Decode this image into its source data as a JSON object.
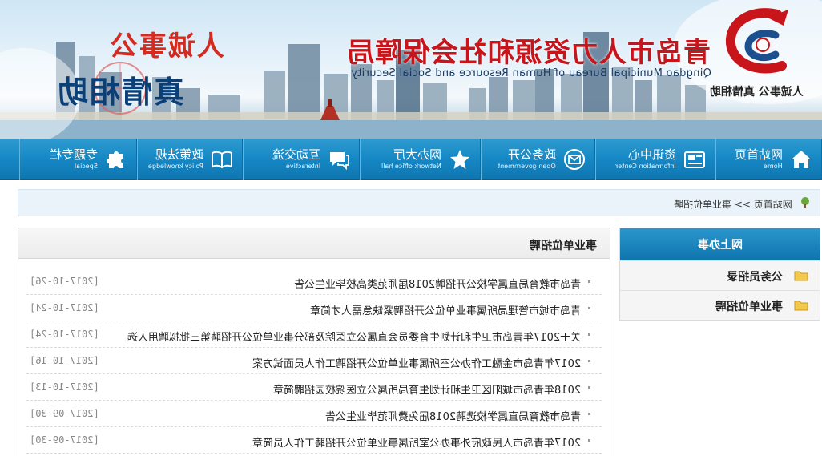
{
  "header": {
    "site_title": "青岛市人力资源和社会保障局",
    "site_subtitle": "Qingdao Municipal Bureau of Human Resource and Social Security",
    "logo_slogan": "人诚事公 真情相助",
    "slogan_line1": "人诚事公",
    "slogan_line2": "真情相助"
  },
  "nav": {
    "items": [
      {
        "label": "网站首页",
        "en": "Home",
        "icon": "home-icon"
      },
      {
        "label": "资讯中心",
        "en": "Information Center",
        "icon": "news-icon"
      },
      {
        "label": "政务公开",
        "en": "Open government",
        "icon": "envelope-icon"
      },
      {
        "label": "网办大厅",
        "en": "Network office hall",
        "icon": "star-icon"
      },
      {
        "label": "互动交流",
        "en": "Interactive",
        "icon": "chat-icon"
      },
      {
        "label": "政策法规",
        "en": "Policy knowledge",
        "icon": "book-icon"
      },
      {
        "label": "专题专栏",
        "en": "Special",
        "icon": "puzzle-icon"
      }
    ]
  },
  "breadcrumb": {
    "text": "网站首页 >> 事业单位招聘",
    "icon": "tree-icon"
  },
  "list": {
    "title": "事业单位招聘",
    "rows": [
      {
        "title": "青岛市教育局直属学校公开招聘2018届师范类高校毕业生公告",
        "date": "[2017-10-26]"
      },
      {
        "title": "青岛市城市管理局所属事业单位公开招聘紧缺急需人才简章",
        "date": "[2017-10-24]"
      },
      {
        "title": "关于2017年青岛市卫生和计划生育委员会直属公立医院及部分事业单位公开招聘第三批拟聘用人选",
        "date": "[2017-10-24]"
      },
      {
        "title": "2017年青岛市金融工作办公室所属事业单位公开招聘工作人员面试方案",
        "date": "[2017-10-16]"
      },
      {
        "title": "2018年青岛市城阳区卫生和计划生育局所属公立医院校园招聘简章",
        "date": "[2017-10-13]"
      },
      {
        "title": "青岛市教育局直属学校选聘2018届免费师范毕业生公告",
        "date": "[2017-09-30]"
      },
      {
        "title": "2017年青岛市人民政府外事办公室所属事业单位公开招聘工作人员简章",
        "date": "[2017-09-30]"
      }
    ]
  },
  "sidebar": {
    "title": "网上办事",
    "items": [
      {
        "label": "公务员招录",
        "icon": "folder-icon"
      },
      {
        "label": "事业单位招聘",
        "icon": "folder-icon"
      }
    ]
  },
  "colors": {
    "nav_blue": "#1688c5",
    "title_red": "#c8151b",
    "crumb_bg": "#e9f3f9"
  }
}
